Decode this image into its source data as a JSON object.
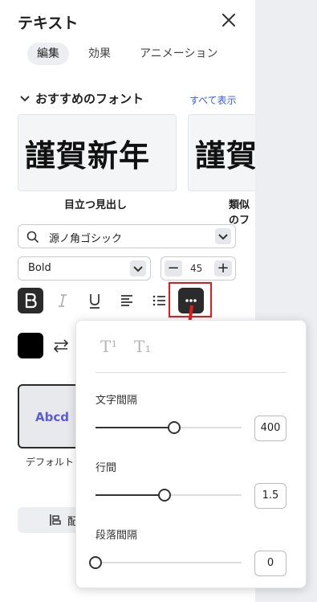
{
  "panel": {
    "title": "テキスト",
    "tabs": [
      "編集",
      "効果",
      "アニメーション"
    ]
  },
  "recommended": {
    "heading": "おすすめのフォント",
    "see_all": "すべて表示",
    "cards": [
      {
        "sample": "謹賀新年",
        "caption": "目立つ見出し"
      },
      {
        "sample": "謹賀新年",
        "caption": "類似のフ"
      }
    ]
  },
  "font_family": {
    "value": "源ノ角ゴシック"
  },
  "font_weight": {
    "value": "Bold"
  },
  "font_size": {
    "value": "45",
    "minus": "−",
    "plus": "+"
  },
  "text_styles": {
    "default_sample": "Abcd",
    "default_caption": "デフォルト"
  },
  "bottom_button": {
    "label": "配"
  },
  "popup": {
    "superscript": "T¹",
    "subscript": "T₁",
    "letter_spacing": {
      "label": "文字間隔",
      "value": "400",
      "fraction": 0.54
    },
    "line_height": {
      "label": "行間",
      "value": "1.5",
      "fraction": 0.47
    },
    "paragraph_spacing": {
      "label": "段落間隔",
      "value": "0",
      "fraction": 0.0
    }
  },
  "colors": {
    "accent": "#3b5bdb",
    "highlight": "#e41b1b",
    "dark": "#2b2b2b"
  }
}
